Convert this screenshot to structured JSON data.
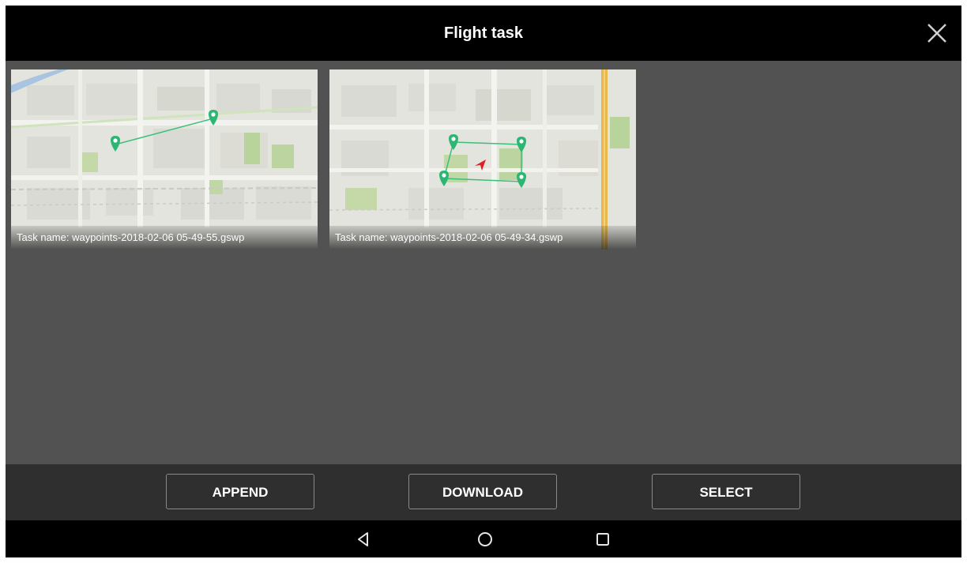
{
  "header": {
    "title": "Flight task",
    "close_icon": "close-icon"
  },
  "tasks": [
    {
      "caption": "Task name: waypoints-2018-02-06 05-49-55.gswp",
      "waypoint_count": 2
    },
    {
      "caption": "Task name: waypoints-2018-02-06 05-49-34.gswp",
      "waypoint_count": 4
    }
  ],
  "actions": {
    "append_label": "APPEND",
    "download_label": "DOWNLOAD",
    "select_label": "SELECT"
  },
  "navigation": {
    "back_icon": "back-triangle-icon",
    "home_icon": "home-circle-icon",
    "recents_icon": "recents-square-icon"
  },
  "colors": {
    "waypoint": "#2bb673",
    "aircraft": "#e02020",
    "background": "#525252",
    "actionbar": "#2f2f2f"
  }
}
